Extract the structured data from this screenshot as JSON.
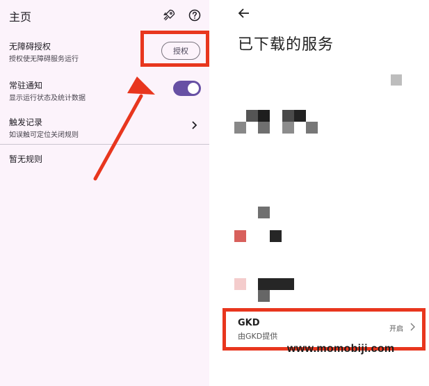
{
  "home": {
    "title": "主页",
    "accessibility": {
      "title": "无障碍授权",
      "subtitle": "授权使无障碍服务运行",
      "button": "授权"
    },
    "notification": {
      "title": "常驻通知",
      "subtitle": "显示运行状态及统计数据",
      "enabled": true
    },
    "trigger_log": {
      "title": "触发记录",
      "subtitle": "如误触可定位关闭规则"
    },
    "no_rules": "暂无规则",
    "icons": [
      "rocket-icon",
      "help-icon",
      "chevron-right-icon"
    ]
  },
  "downloaded": {
    "title": "已下载的服务",
    "service": {
      "name": "GKD",
      "provider": "由GKD提供",
      "status": "开启"
    }
  },
  "watermark": "www.momobiji.com",
  "colors": {
    "accent": "#6750a4",
    "highlight": "#e8361e",
    "left_bg": "#fcf3fb"
  }
}
